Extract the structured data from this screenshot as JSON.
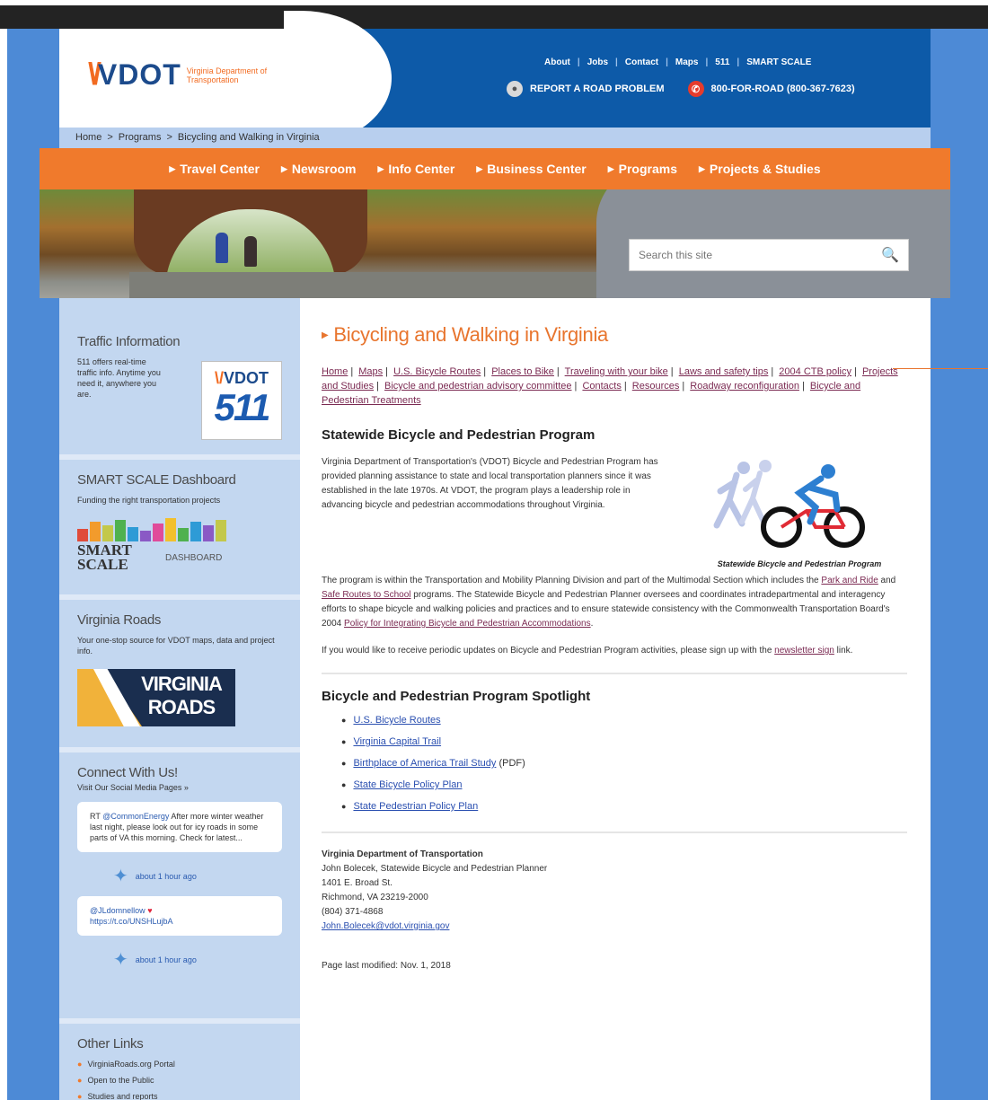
{
  "header": {
    "logo_text": "VDOT",
    "logo_subtitle": "Virginia Department of Transportation",
    "utility_nav": [
      "About",
      "Jobs",
      "Contact",
      "Maps",
      "511",
      "SMART SCALE"
    ],
    "report_label": "REPORT A ROAD PROBLEM",
    "phone_label": "800-FOR-ROAD (800-367-7623)"
  },
  "breadcrumb": [
    "Home",
    "Programs",
    "Bicycling and Walking in Virginia"
  ],
  "main_nav": [
    "Travel Center",
    "Newsroom",
    "Info Center",
    "Business Center",
    "Programs",
    "Projects & Studies"
  ],
  "search": {
    "placeholder": "Search this site"
  },
  "sidebar": {
    "traffic": {
      "title": "Traffic Information",
      "text": "511 offers real-time traffic info. Anytime you need it, anywhere you are.",
      "logo_top": "VDOT",
      "logo_num": "511"
    },
    "smart": {
      "title": "SMART SCALE Dashboard",
      "text": "Funding the right transportation projects",
      "logo_word": "SMART SCALE",
      "logo_dash": "DASHBOARD"
    },
    "roads": {
      "title": "Virginia Roads",
      "text": "Your one-stop source for VDOT maps, data and project info.",
      "logo_text": "VIRGINIA ROADS"
    },
    "connect": {
      "title": "Connect With Us!",
      "subtitle": "Visit Our Social Media Pages »",
      "tweet1_handle": "@CommonEnergy",
      "tweet1_prefix": "RT ",
      "tweet1_text": " After more winter weather last night, please look out for icy roads in some parts of VA this morning. Check for latest...",
      "tweet1_meta": "about 1 hour ago",
      "tweet2_handle": "@JLdomnellow",
      "tweet2_link": "https://t.co/UNSHLujbA",
      "tweet2_meta": "about 1 hour ago"
    },
    "other": {
      "title": "Other Links",
      "items": [
        "VirginiaRoads.org Portal",
        "Open to the Public",
        "Studies and reports"
      ]
    }
  },
  "content": {
    "title": "Bicycling and Walking in Virginia",
    "sublinks": [
      "Home",
      "Maps",
      "U.S. Bicycle Routes",
      "Places to Bike",
      "Traveling with your bike",
      "Laws and safety tips",
      "2004 CTB policy",
      "Projects and Studies",
      "Bicycle and pedestrian advisory committee",
      "Contacts",
      "Resources",
      "Roadway reconfiguration",
      "Bicycle and Pedestrian Treatments"
    ],
    "program_heading": "Statewide Bicycle and Pedestrian Program",
    "program_p1": "Virginia Department of Transportation's (VDOT) Bicycle and Pedestrian Program has provided planning assistance to state and local transportation planners since it was established in the late 1970s. At VDOT, the program plays a leadership role in advancing bicycle and pedestrian accommodations throughout Virginia.",
    "program_p2_a": "The program is within the Transportation and Mobility Planning Division and part of the Multimodal Section which includes the ",
    "program_p2_link1": "Park and Ride",
    "program_p2_b": " and ",
    "program_p2_link2": "Safe Routes to School",
    "program_p2_c": " programs. The Statewide Bicycle and Pedestrian Planner oversees and coordinates intradepartmental and interagency efforts to shape bicycle and walking policies and practices and to ensure statewide consistency with the Commonwealth Transportation Board's 2004 ",
    "program_p2_link3": "Policy for Integrating Bicycle and Pedestrian Accommodations",
    "program_p2_d": ".",
    "program_p3_a": "If you would like to receive periodic updates on Bicycle and Pedestrian Program activities, please sign up with the ",
    "program_p3_link": "newsletter sign",
    "program_p3_b": " link.",
    "logo_caption": "Statewide Bicycle and Pedestrian Program",
    "spotlight_heading": "Bicycle and Pedestrian Program Spotlight",
    "spotlight_items": [
      {
        "link": "U.S. Bicycle Routes",
        "suffix": ""
      },
      {
        "link": "Virginia Capital Trail",
        "suffix": ""
      },
      {
        "link": "Birthplace of America Trail Study",
        "suffix": " (PDF)"
      },
      {
        "link": "State Bicycle Policy Plan",
        "suffix": ""
      },
      {
        "link": "State Pedestrian Policy Plan",
        "suffix": ""
      }
    ],
    "contact_org": "Virginia Department of Transportation",
    "contact_name": "John Bolecek, Statewide Bicycle and Pedestrian Planner",
    "contact_street": "1401 E. Broad St.",
    "contact_city": "Richmond, VA 23219-2000",
    "contact_phone": "(804) 371-4868",
    "contact_email": "John.Bolecek@vdot.virginia.gov",
    "modified": "Page last modified: Nov. 1, 2018"
  },
  "colors": {
    "brand_orange": "#f07a2c",
    "brand_blue": "#0d5aa8",
    "link_maroon": "#7b2a52"
  }
}
